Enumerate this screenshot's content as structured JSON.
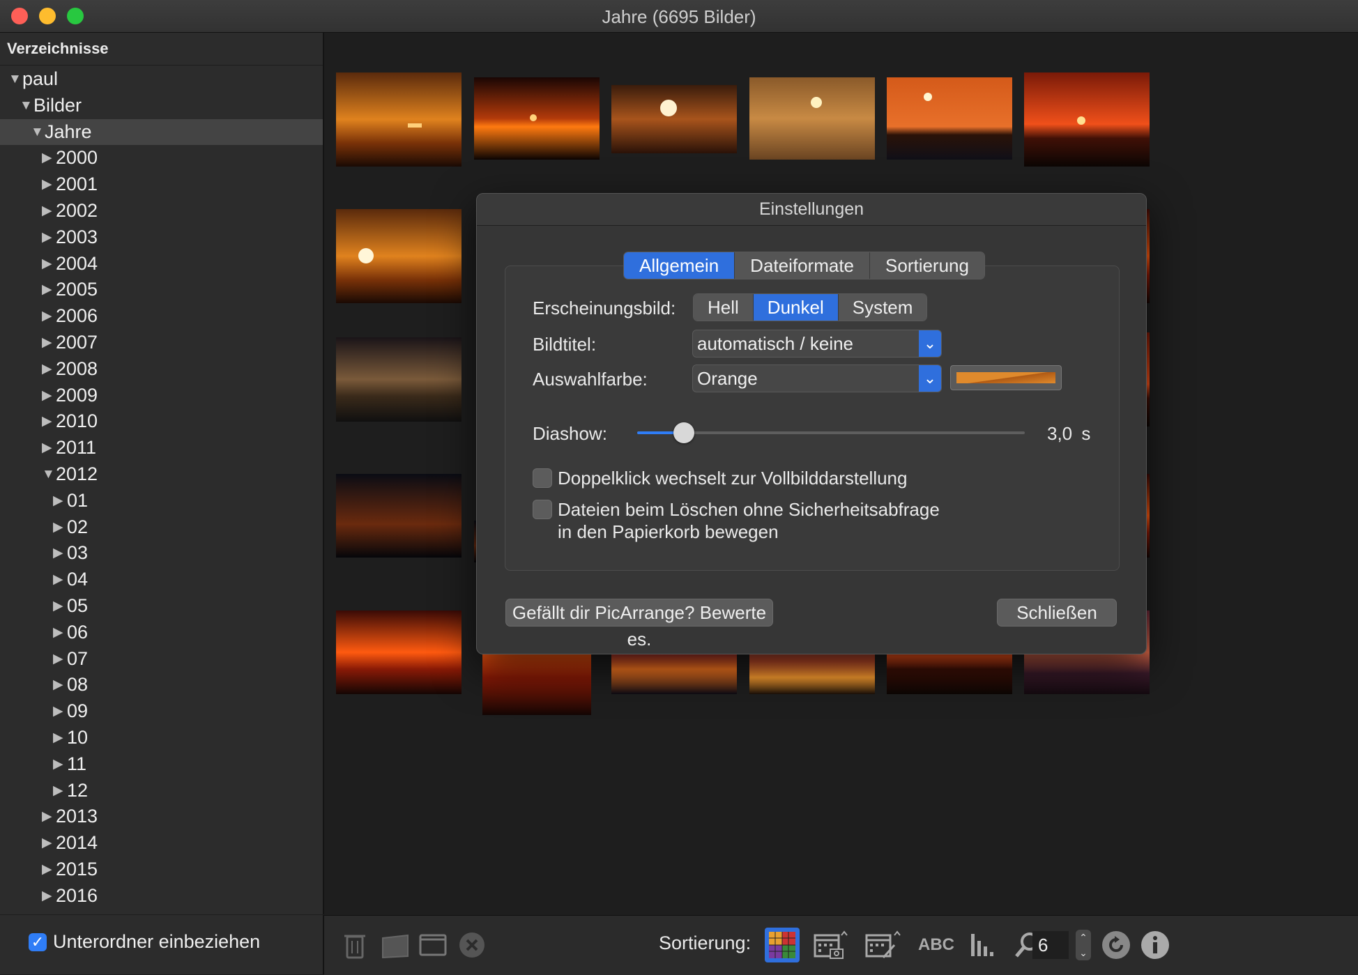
{
  "window": {
    "title": "Jahre (6695 Bilder)"
  },
  "sidebar": {
    "header": "Verzeichnisse",
    "tree": [
      {
        "label": "paul",
        "level": 0,
        "expanded": true
      },
      {
        "label": "Bilder",
        "level": 1,
        "expanded": true
      },
      {
        "label": "Jahre",
        "level": 2,
        "expanded": true,
        "selected": true
      },
      {
        "label": "2000",
        "level": 3,
        "expanded": false
      },
      {
        "label": "2001",
        "level": 3,
        "expanded": false
      },
      {
        "label": "2002",
        "level": 3,
        "expanded": false
      },
      {
        "label": "2003",
        "level": 3,
        "expanded": false
      },
      {
        "label": "2004",
        "level": 3,
        "expanded": false
      },
      {
        "label": "2005",
        "level": 3,
        "expanded": false
      },
      {
        "label": "2006",
        "level": 3,
        "expanded": false
      },
      {
        "label": "2007",
        "level": 3,
        "expanded": false
      },
      {
        "label": "2008",
        "level": 3,
        "expanded": false
      },
      {
        "label": "2009",
        "level": 3,
        "expanded": false
      },
      {
        "label": "2010",
        "level": 3,
        "expanded": false
      },
      {
        "label": "2011",
        "level": 3,
        "expanded": false
      },
      {
        "label": "2012",
        "level": 3,
        "expanded": true
      },
      {
        "label": "01",
        "level": 4,
        "expanded": false
      },
      {
        "label": "02",
        "level": 4,
        "expanded": false
      },
      {
        "label": "03",
        "level": 4,
        "expanded": false
      },
      {
        "label": "04",
        "level": 4,
        "expanded": false
      },
      {
        "label": "05",
        "level": 4,
        "expanded": false
      },
      {
        "label": "06",
        "level": 4,
        "expanded": false
      },
      {
        "label": "07",
        "level": 4,
        "expanded": false
      },
      {
        "label": "08",
        "level": 4,
        "expanded": false
      },
      {
        "label": "09",
        "level": 4,
        "expanded": false
      },
      {
        "label": "10",
        "level": 4,
        "expanded": false
      },
      {
        "label": "11",
        "level": 4,
        "expanded": false
      },
      {
        "label": "12",
        "level": 4,
        "expanded": false
      },
      {
        "label": "2013",
        "level": 3,
        "expanded": false
      },
      {
        "label": "2014",
        "level": 3,
        "expanded": false
      },
      {
        "label": "2015",
        "level": 3,
        "expanded": false
      },
      {
        "label": "2016",
        "level": 3,
        "expanded": false
      }
    ],
    "footer": {
      "checkbox_label": "Unterordner einbeziehen",
      "checked": true
    }
  },
  "toolbar": {
    "sort_label": "Sortierung:",
    "abc_label": "ABC",
    "columns_value": "6",
    "icons": [
      "trash-icon",
      "folder-icon",
      "window-icon",
      "close-circle-icon",
      "color-grid-icon",
      "calendar-camera-icon",
      "calendar-edit-icon",
      "abc-icon",
      "bar-chart-icon",
      "search-icon",
      "refresh-icon",
      "info-icon"
    ]
  },
  "dialog": {
    "title": "Einstellungen",
    "tabs": [
      {
        "label": "Allgemein",
        "active": true
      },
      {
        "label": "Dateiformate",
        "active": false
      },
      {
        "label": "Sortierung",
        "active": false
      }
    ],
    "appearance_label": "Erscheinungsbild:",
    "appearance_options": [
      {
        "label": "Hell",
        "active": false
      },
      {
        "label": "Dunkel",
        "active": true
      },
      {
        "label": "System",
        "active": false
      }
    ],
    "title_label": "Bildtitel:",
    "title_value": "automatisch / keine",
    "color_label": "Auswahlfarbe:",
    "color_value": "Orange",
    "color_swatch": "#e08a2c",
    "slideshow_label": "Diashow:",
    "slideshow_value": "3,0",
    "slideshow_unit": "s",
    "slideshow_level": 0.12,
    "check1_label": "Doppelklick wechselt zur Vollbilddarstellung",
    "check1_checked": false,
    "check2_line1": "Dateien beim Löschen ohne Sicherheitsabfrage",
    "check2_line2": "in den Papierkorb bewegen",
    "check2_checked": false,
    "rate_button": "Gefällt dir PicArrange? Bewerte es.",
    "close_button": "Schließen"
  },
  "colors": {
    "accent": "#2f6fdd",
    "selection_orange": "#e08a2c"
  }
}
